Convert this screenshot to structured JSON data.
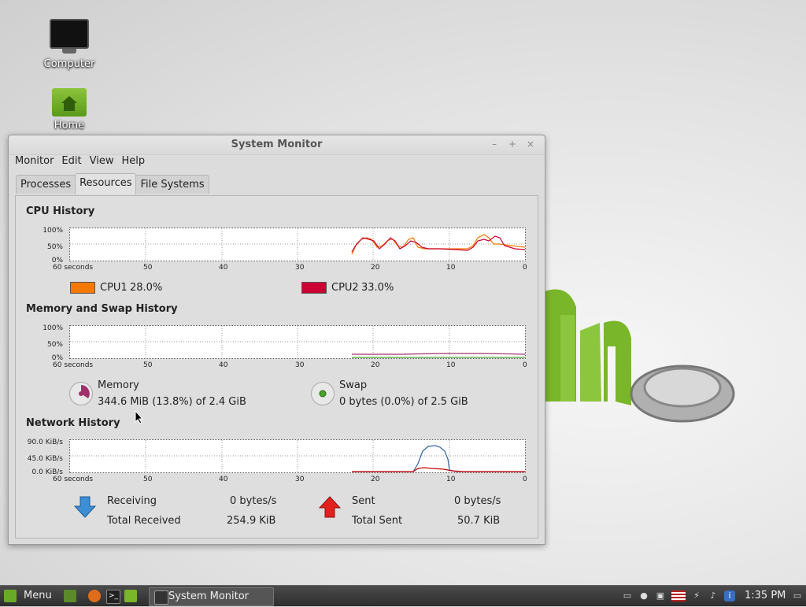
{
  "desktop": {
    "icons": [
      {
        "label": "Computer"
      },
      {
        "label": "Home"
      }
    ]
  },
  "window": {
    "title": "System Monitor",
    "controls": {
      "minimize": "–",
      "maximize": "+",
      "close": "×"
    },
    "menu": [
      "Monitor",
      "Edit",
      "View",
      "Help"
    ],
    "tabs": [
      {
        "label": "Processes",
        "active": false
      },
      {
        "label": "Resources",
        "active": true
      },
      {
        "label": "File Systems",
        "active": false
      }
    ]
  },
  "cpu": {
    "title": "CPU History",
    "y_ticks": [
      "100%",
      "50%",
      "0%"
    ],
    "x_ticks": [
      "60 seconds",
      "50",
      "40",
      "30",
      "20",
      "10",
      "0"
    ],
    "legend": [
      {
        "name": "CPU1",
        "value": "28.0%",
        "color": "#f57900"
      },
      {
        "name": "CPU2",
        "value": "33.0%",
        "color": "#cc0033"
      }
    ]
  },
  "memory": {
    "title": "Memory and Swap History",
    "y_ticks": [
      "100%",
      "50%",
      "0%"
    ],
    "x_ticks": [
      "60 seconds",
      "50",
      "40",
      "30",
      "20",
      "10",
      "0"
    ],
    "memory_label": "Memory",
    "memory_value": "344.6 MiB (13.8%) of 2.4 GiB",
    "swap_label": "Swap",
    "swap_value": "0 bytes (0.0%) of 2.5 GiB",
    "memory_color": "#a0306a",
    "swap_color": "#4aa02c"
  },
  "network": {
    "title": "Network History",
    "y_ticks": [
      "90.0 KiB/s",
      "45.0 KiB/s",
      "0.0 KiB/s"
    ],
    "x_ticks": [
      "60 seconds",
      "50",
      "40",
      "30",
      "20",
      "10",
      "0"
    ],
    "receiving_label": "Receiving",
    "receiving_value": "0 bytes/s",
    "total_received_label": "Total Received",
    "total_received_value": "254.9 KiB",
    "sent_label": "Sent",
    "sent_value": "0 bytes/s",
    "total_sent_label": "Total Sent",
    "total_sent_value": "50.7 KiB",
    "receiving_color": "#3465a4",
    "sent_color": "#cc0000"
  },
  "taskbar": {
    "menu_label": "Menu",
    "task_label": "System Monitor",
    "clock": "1:35 PM"
  }
}
